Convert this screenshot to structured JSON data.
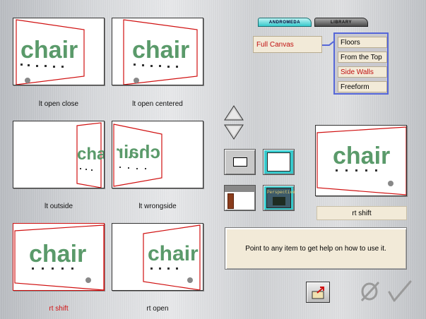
{
  "tabs": [
    {
      "label": "ANDROMEDA",
      "active": true
    },
    {
      "label": "LIBRARY",
      "active": false
    }
  ],
  "canvas_option": "Full Canvas",
  "view_menu": [
    {
      "label": "Floors",
      "active": false
    },
    {
      "label": "From the Top",
      "active": false
    },
    {
      "label": "Side Walls",
      "active": true
    },
    {
      "label": "Freeform",
      "active": false
    }
  ],
  "thumbnails": [
    {
      "label": "lt open close",
      "selected": false
    },
    {
      "label": "lt open centered",
      "selected": false
    },
    {
      "label": "lt outside",
      "selected": false
    },
    {
      "label": "lt wrongside",
      "selected": false
    },
    {
      "label": "rt shift",
      "selected": true
    },
    {
      "label": "rt open",
      "selected": false
    }
  ],
  "art_text": "chair",
  "perspective_button_text": "Perspective",
  "preview_name": "rt shift",
  "help_text": "Point to any item to get help on how to use it.",
  "colors": {
    "selected_red": "#d01010",
    "chair_green": "#5a9a6a",
    "menu_border": "#5566d8",
    "tab_active": "#36c9cc",
    "panel_cream": "#f2ead8"
  },
  "icons": {
    "up": "arrow-up-icon",
    "down": "arrow-down-icon",
    "cancel": "cancel-icon",
    "ok": "checkmark-icon",
    "open": "open-folder-icon"
  }
}
